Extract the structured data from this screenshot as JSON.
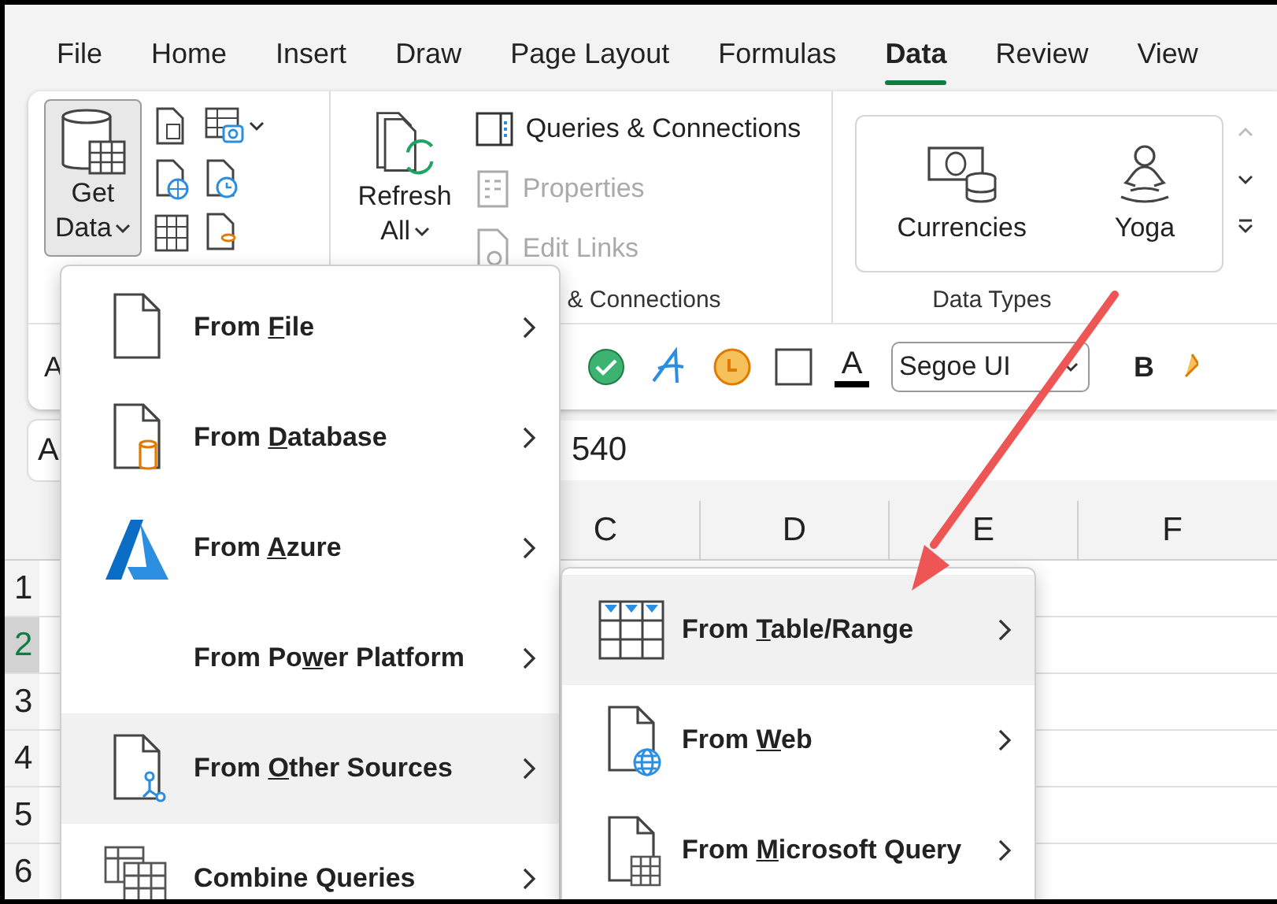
{
  "menu_bar": {
    "tabs": [
      {
        "label": "File",
        "selected": false
      },
      {
        "label": "Home",
        "selected": false
      },
      {
        "label": "Insert",
        "selected": false
      },
      {
        "label": "Draw",
        "selected": false
      },
      {
        "label": "Page Layout",
        "selected": false
      },
      {
        "label": "Formulas",
        "selected": false
      },
      {
        "label": "Data",
        "selected": true
      },
      {
        "label": "Review",
        "selected": false
      },
      {
        "label": "View",
        "selected": false
      }
    ]
  },
  "ribbon": {
    "get_data": {
      "line_1": "Get",
      "line_2": "Data",
      "selected": true
    },
    "refresh_all": {
      "line_1": "Refresh",
      "line_2": "All"
    },
    "queries": [
      {
        "kind": "queries",
        "label": "Queries & Connections",
        "disabled": false
      },
      {
        "kind": "properties",
        "label": "Properties",
        "disabled": true
      },
      {
        "kind": "links",
        "label": "Edit Links",
        "disabled": true
      }
    ],
    "group_labels": [
      "& Connections",
      "Data Types"
    ],
    "data_types": [
      {
        "kind": "currency",
        "label": "Currencies"
      },
      {
        "kind": "yoga",
        "label": "Yoga"
      }
    ]
  },
  "quick_toolbar": {
    "left_label": "A",
    "font": "Segoe UI",
    "font_color": "A",
    "bold": "B"
  },
  "formula_bar": {
    "name_box": "A",
    "value": "540"
  },
  "grid": {
    "columns": [
      "C",
      "D",
      "E",
      "F"
    ],
    "rows": [
      {
        "label": "1",
        "selected": false
      },
      {
        "label": "2",
        "selected": true
      },
      {
        "label": "3",
        "selected": false
      },
      {
        "label": "4",
        "selected": false
      },
      {
        "label": "5",
        "selected": false
      },
      {
        "label": "6",
        "selected": false
      }
    ]
  },
  "get_data_menu": {
    "items": [
      {
        "kind": "file",
        "before": "From ",
        "key": "F",
        "after": "ile",
        "selected": false
      },
      {
        "kind": "database",
        "before": "From ",
        "key": "D",
        "after": "atabase",
        "selected": false
      },
      {
        "kind": "azure",
        "before": "From ",
        "key": "A",
        "after": "zure",
        "selected": false
      },
      {
        "kind": "blank",
        "before": "From Po",
        "key": "w",
        "after": "er Platform",
        "selected": false
      },
      {
        "kind": "other",
        "before": "From ",
        "key": "O",
        "after": "ther Sources",
        "selected": true
      },
      {
        "kind": "combine",
        "before": "Combine Queries",
        "selected": false
      }
    ]
  },
  "submenu": {
    "items": [
      {
        "kind": "table",
        "before": "From ",
        "key": "T",
        "after": "able/Range",
        "selected": true
      },
      {
        "kind": "web",
        "before": "From ",
        "key": "W",
        "after": "eb",
        "selected": false
      },
      {
        "kind": "query",
        "before": "From ",
        "key": "M",
        "after": "icrosoft Query",
        "selected": false
      }
    ]
  }
}
